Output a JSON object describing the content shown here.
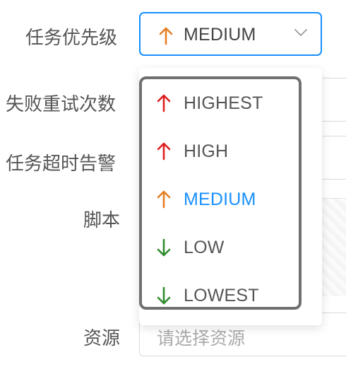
{
  "form": {
    "priority_label": "任务优先级",
    "retry_label": "失败重试次数",
    "timeout_label": "任务超时告警",
    "script_label": "脚本",
    "resource_label": "资源",
    "resource_placeholder": "请选择资源"
  },
  "priority_select": {
    "value": "MEDIUM",
    "value_icon": "arrow-up-icon",
    "value_color": "#e67e22",
    "options": [
      {
        "label": "HIGHEST",
        "icon": "arrow-up-icon",
        "color": "#e01e1e"
      },
      {
        "label": "HIGH",
        "icon": "arrow-up-icon",
        "color": "#e01e1e"
      },
      {
        "label": "MEDIUM",
        "icon": "arrow-up-icon",
        "color": "#e67e22",
        "selected": true
      },
      {
        "label": "LOW",
        "icon": "arrow-down-icon",
        "color": "#2e8b2e"
      },
      {
        "label": "LOWEST",
        "icon": "arrow-down-icon",
        "color": "#2e8b2e"
      }
    ]
  },
  "colors": {
    "accent": "#1890ff",
    "up_red": "#e01e1e",
    "up_orange": "#e67e22",
    "down_green": "#2e8b2e"
  }
}
